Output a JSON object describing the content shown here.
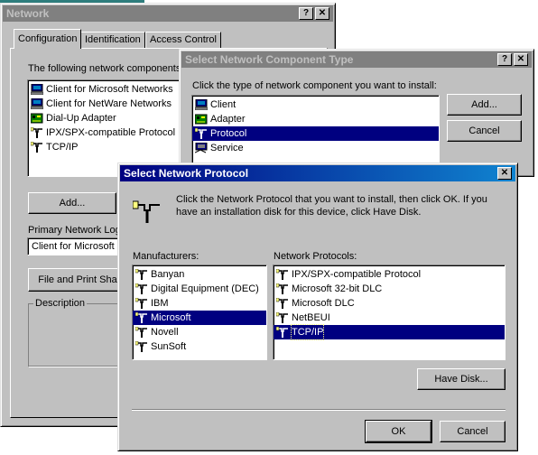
{
  "network": {
    "title": "Network",
    "tabs": [
      "Configuration",
      "Identification",
      "Access Control"
    ],
    "components_label": "The following network components",
    "components": [
      {
        "label": "Client for Microsoft Networks",
        "icon": "network-client-icon"
      },
      {
        "label": "Client for NetWare Networks",
        "icon": "network-client-icon"
      },
      {
        "label": "Dial-Up Adapter",
        "icon": "adapter-icon"
      },
      {
        "label": "IPX/SPX-compatible Protocol",
        "icon": "protocol-icon"
      },
      {
        "label": "TCP/IP",
        "icon": "protocol-icon"
      }
    ],
    "add_button": "Add...",
    "primary_logon_label": "Primary Network Logo",
    "primary_logon_value": "Client for Microsoft N",
    "file_print_button": "File and Print Sha",
    "description_label": "Description"
  },
  "component_type": {
    "title": "Select Network Component Type",
    "instruction": "Click the type of network component you want to install:",
    "items": [
      {
        "label": "Client",
        "icon": "client-icon"
      },
      {
        "label": "Adapter",
        "icon": "adapter-icon"
      },
      {
        "label": "Protocol",
        "icon": "protocol-icon",
        "selected": true
      },
      {
        "label": "Service",
        "icon": "service-icon"
      }
    ],
    "add_button": "Add...",
    "cancel_button": "Cancel"
  },
  "protocol": {
    "title": "Select Network Protocol",
    "instruction": "Click the Network Protocol that you want to install, then click OK. If you have an installation disk for this device, click Have Disk.",
    "manufacturers_label": "Manufacturers:",
    "manufacturers": [
      "Banyan",
      "Digital Equipment (DEC)",
      "IBM",
      "Microsoft",
      "Novell",
      "SunSoft"
    ],
    "manufacturers_selected": "Microsoft",
    "protocols_label": "Network Protocols:",
    "protocols": [
      "IPX/SPX-compatible Protocol",
      "Microsoft 32-bit DLC",
      "Microsoft DLC",
      "NetBEUI",
      "TCP/IP"
    ],
    "protocols_selected": "TCP/IP",
    "have_disk_button": "Have Disk...",
    "ok_button": "OK",
    "cancel_button": "Cancel"
  },
  "colors": {
    "face": "#c0c0c0",
    "selection": "#000080",
    "title_active": "#000080",
    "title_inactive": "#808080"
  }
}
